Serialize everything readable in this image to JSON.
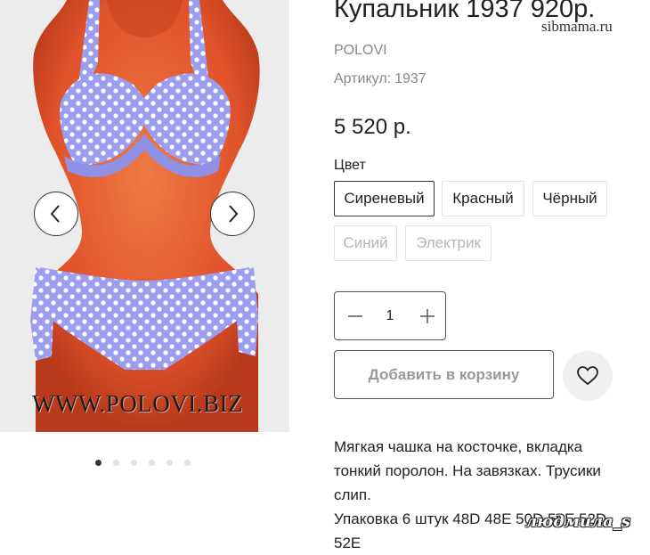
{
  "product": {
    "title": "Купальник 1937 920р.",
    "brand": "POLOVI",
    "sku_label": "Артикул:",
    "sku_value": "1937",
    "price": "5 520 р."
  },
  "gallery": {
    "photo_watermark": "WWW.POLOVI.BIZ",
    "slide_count": 6,
    "active_slide": 1,
    "swimsuit_color": "#9b9ef0",
    "mannequin_color": "#e0522a"
  },
  "colors": {
    "label": "Цвет",
    "options": [
      "Сиреневый",
      "Красный",
      "Чёрный",
      "Синий",
      "Электрик"
    ],
    "selected": "Сиреневый"
  },
  "quantity": {
    "value": "1"
  },
  "cart": {
    "add_label": "Добавить в корзину"
  },
  "description": {
    "text": "Мягкая чашка на косточке, вкладка тонкий поролон. На завязках. Трусики слип.",
    "packaging": "Упаковка 6 штук 48D 48E 50D 50E 52D 52E"
  },
  "watermarks": {
    "site": "sibmama.ru",
    "user": "людмила_s"
  },
  "icons": {
    "prev": "chevron-left-icon",
    "next": "chevron-right-icon",
    "minus": "minus-icon",
    "plus": "plus-icon",
    "wishlist": "heart-icon"
  }
}
